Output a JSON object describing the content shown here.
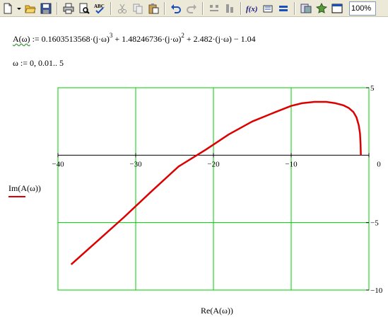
{
  "toolbar": {
    "zoom": "100%",
    "buttons": [
      "new-document",
      "open-folder",
      "save",
      "print",
      "print-preview",
      "spell-check",
      "cut",
      "copy",
      "paste",
      "undo",
      "redo",
      "align",
      "function",
      "insert-unit",
      "calculate",
      "component",
      "resource",
      "toggle-window"
    ]
  },
  "worksheet": {
    "def_lhs": "A(ω)",
    "def_rhs": [
      {
        "text": " := 0.1603513568·(j·ω)"
      },
      {
        "sup": "3"
      },
      {
        "text": " + 1.48246736·(j·ω)"
      },
      {
        "sup": "2"
      },
      {
        "text": " + 2.482·(j·ω) − 1.04"
      }
    ],
    "range_def": "ω := 0, 0.01.. 5"
  },
  "chart_data": {
    "type": "line",
    "xlabel": "Re(A(ω))",
    "ylabel": "Im(A(ω))",
    "xlim": [
      -40,
      0
    ],
    "ylim": [
      -10,
      5
    ],
    "x_ticks": [
      "−40",
      "−30",
      "−20",
      "−10",
      "0"
    ],
    "y_ticks": [
      "5",
      "−5",
      "−10"
    ],
    "grid": true,
    "colors": {
      "trace": "#dd0000",
      "grid": "#00cc00",
      "frame": "#00cc00",
      "axis": "#000000"
    },
    "series": [
      {
        "x": [
          -1.04,
          -1.07,
          -1.15,
          -1.3,
          -1.6,
          -2.0,
          -2.6,
          -3.3,
          -4.3,
          -5.5,
          -7.0,
          -8.6,
          -10.0,
          -12.0,
          -15.0,
          -18.0,
          -21.0,
          -24.5,
          -28.0,
          -31.5,
          -35.0,
          -38.3
        ],
        "y": [
          0.0,
          0.8,
          1.6,
          2.2,
          2.8,
          3.2,
          3.5,
          3.7,
          3.85,
          3.95,
          3.95,
          3.85,
          3.65,
          3.2,
          2.5,
          1.55,
          0.4,
          -0.85,
          -2.7,
          -4.6,
          -6.4,
          -8.1
        ]
      }
    ]
  }
}
